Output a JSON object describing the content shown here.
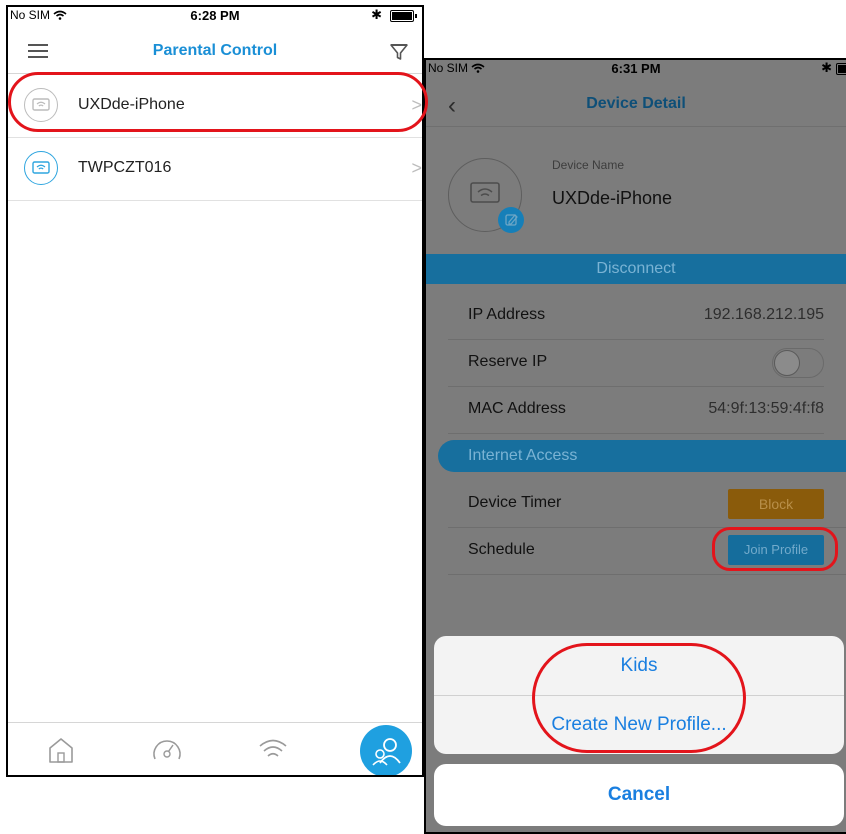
{
  "left_phone": {
    "status": {
      "carrier": "No SIM",
      "time": "6:28 PM",
      "bluetooth": "✱"
    },
    "nav": {
      "title": "Parental Control"
    },
    "devices": [
      {
        "name": "UXDde-iPhone",
        "chevron": ">",
        "icon": "wifi-device-icon"
      },
      {
        "name": "TWPCZT016",
        "chevron": ">",
        "icon": "wifi-device-icon"
      }
    ],
    "tabs": [
      "home-icon",
      "speedometer-icon",
      "wifi-icon",
      "parental-control-icon"
    ]
  },
  "right_phone": {
    "status": {
      "carrier": "No SIM",
      "time": "6:31 PM",
      "bluetooth": "✱"
    },
    "nav": {
      "title": "Device Detail",
      "back": "‹"
    },
    "device": {
      "name_label": "Device Name",
      "name_value": "UXDde-iPhone"
    },
    "disconnect_label": "Disconnect",
    "rows": {
      "ip_label": "IP Address",
      "ip_value": "192.168.212.195",
      "reserve_label": "Reserve IP",
      "mac_label": "MAC Address",
      "mac_value": "54:9f:13:59:4f:f8"
    },
    "internet_access_label": "Internet Access",
    "timer": {
      "label": "Device Timer",
      "button": "Block"
    },
    "schedule": {
      "label": "Schedule",
      "button": "Join Profile"
    },
    "action_sheet": {
      "option1": "Kids",
      "option2": "Create New Profile...",
      "cancel": "Cancel"
    }
  },
  "colors": {
    "accent": "#1a8fd6",
    "annotation": "#e3141b",
    "block_button": "#8a5b0b",
    "overlay": "#7c7c7c"
  }
}
